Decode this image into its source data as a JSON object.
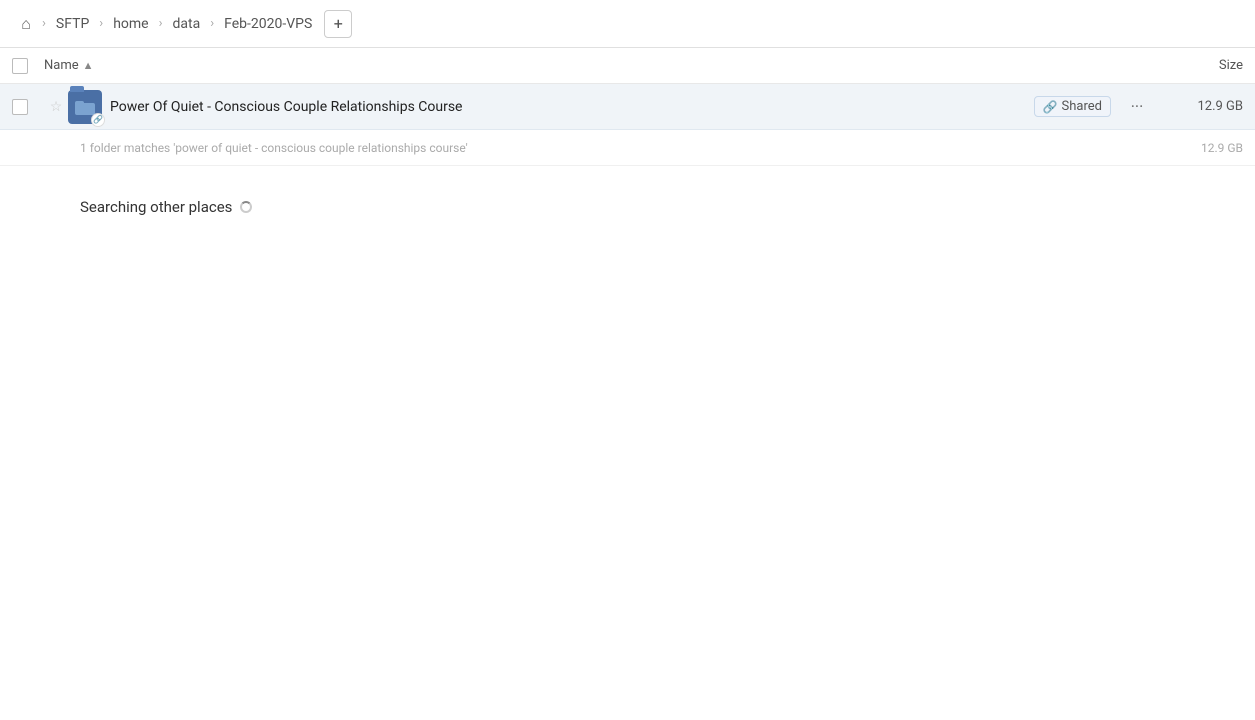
{
  "header": {
    "home_icon": "⌂",
    "breadcrumbs": [
      {
        "label": "SFTP"
      },
      {
        "label": "home"
      },
      {
        "label": "data"
      },
      {
        "label": "Feb-2020-VPS"
      }
    ],
    "add_button_label": "+"
  },
  "columns": {
    "name_label": "Name",
    "sort_arrow": "▲",
    "size_label": "Size"
  },
  "file_row": {
    "name": "Power Of Quiet - Conscious Couple Relationships Course",
    "shared_label": "Shared",
    "size": "12.9 GB",
    "more_icon": "···",
    "link_icon": "🔗"
  },
  "match_info": {
    "text": "1 folder matches 'power of quiet - conscious couple relationships course'",
    "size": "12.9 GB"
  },
  "searching_section": {
    "title": "Searching other places"
  }
}
